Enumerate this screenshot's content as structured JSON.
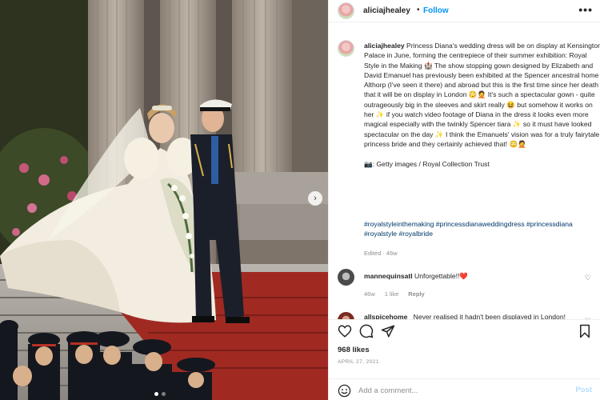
{
  "post": {
    "username": "aliciajhealey",
    "follow_label": "Follow",
    "separator": "•",
    "more": "•••"
  },
  "caption": {
    "username": "aliciajhealey",
    "text": "Princess Diana's wedding dress will be on display at Kensington Palace in June, forming the centrepiece of their summer exhibition: Royal Style in the Making 🏰 The show stopping gown designed by Elizabeth and David Emanuel has previously been exhibited at the Spencer ancestral home Althorp (I've seen it there) and abroad but this is the first time since her death that it will be on display in London 😳🤦 It's such a spectacular gown - quite outrageously big in the sleeves and skirt really 😆 but somehow it works on her ✨ if you watch video footage of Diana in the dress it looks even more magical especially with the twinkly Spencer tiara ✨ so it must have looked spectacular on the day ✨ I think the Emanuels' vision was for a truly fairytale princess bride and they certainly achieved that! 😳🤦\n\n📷: Getty images / Royal Collection Trust",
    "hashtags": "#royalstyleinthemaking #princessdianaweddingdress #princessdiana #royalstyle #royalbride",
    "edited": "Edited · 46w"
  },
  "comments": [
    {
      "username": "mannequinsatl",
      "text": "Unforgettable!!❤️",
      "age": "46w",
      "likes": "1 like",
      "reply": "Reply"
    },
    {
      "username": "allspicehome_",
      "text": "Never realised it hadn't been displayed in London!"
    }
  ],
  "actions": {
    "likes": "968 likes",
    "date": "APRIL 27, 2021",
    "add_comment_placeholder": "Add a comment...",
    "post_label": "Post"
  },
  "carousel": {
    "slide_count": 2,
    "active_index": 0,
    "next_glyph": "›"
  },
  "colors": {
    "link": "#0095f6",
    "hashtag": "#00376b",
    "muted": "#8e8e8e",
    "heart_red": "#ed4956"
  }
}
